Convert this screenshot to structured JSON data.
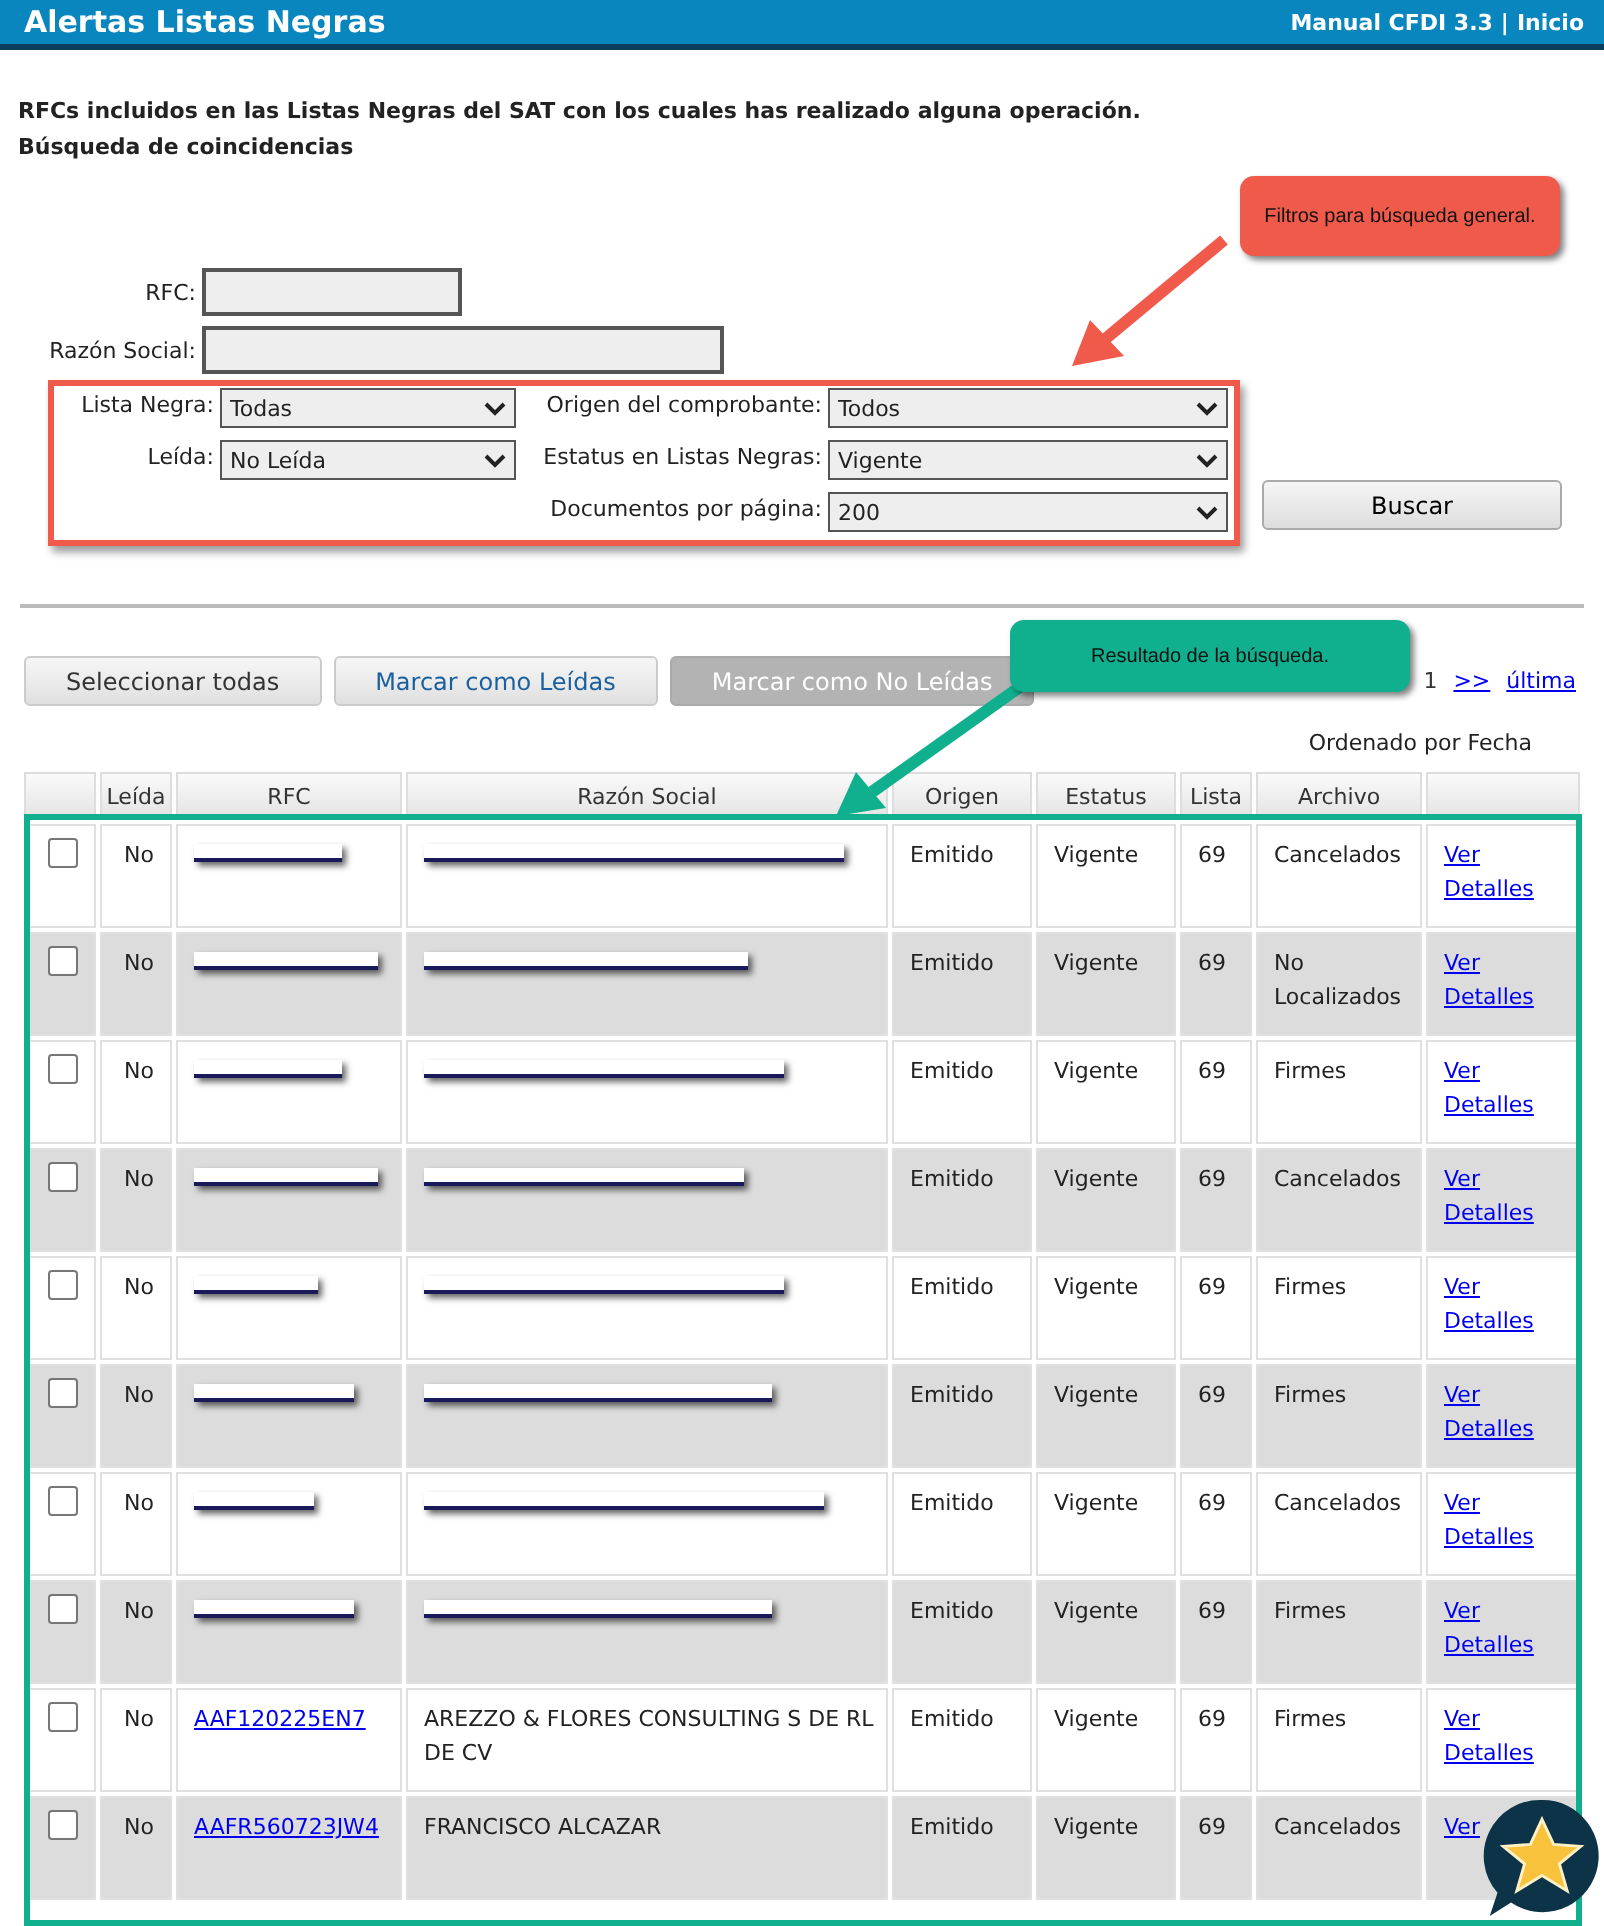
{
  "header": {
    "title": "Alertas Listas Negras",
    "links": [
      "Manual CFDI 3.3",
      "Inicio"
    ],
    "separator": "|"
  },
  "intro": [
    "RFCs incluidos en las Listas Negras del SAT con los cuales has realizado alguna operación.",
    "Búsqueda de coincidencias"
  ],
  "callouts": [
    {
      "text": "Filtros para búsqueda general.",
      "color": "#f05a4b"
    },
    {
      "text": "Resultado de la búsqueda.",
      "color": "#10b08e"
    }
  ],
  "search_fields": [
    {
      "label": "RFC:",
      "kind": "short"
    },
    {
      "label": "Razón Social:",
      "kind": "long"
    }
  ],
  "filters": [
    {
      "label": "Lista Negra:",
      "value": "Todas"
    },
    {
      "label": "Origen del comprobante:",
      "value": "Todos"
    },
    {
      "label": "Leída:",
      "value": "No Leída"
    },
    {
      "label": "Estatus en Listas Negras:",
      "value": "Vigente"
    },
    {
      "label": "Documentos por página:",
      "value": "200"
    }
  ],
  "search_button": "Buscar",
  "actions": [
    {
      "label": "Seleccionar todas",
      "disabled": false,
      "kind": "plain"
    },
    {
      "label": "Marcar como Leídas",
      "disabled": false,
      "kind": "accent"
    },
    {
      "label": "Marcar como No Leídas",
      "disabled": true,
      "kind": "plain"
    }
  ],
  "pager": {
    "page": "1",
    "next": ">>",
    "last": "última"
  },
  "sort_note": "Ordenado por Fecha",
  "table": {
    "columns": [
      "Leída",
      "RFC",
      "Razón Social",
      "Origen",
      "Estatus",
      "Lista",
      "Archivo"
    ],
    "rows": [
      {
        "checked": false,
        "leida": "No",
        "redacted": true,
        "origen": "Emitido",
        "estatus": "Vigente",
        "lista": "69",
        "archivo": "Cancelados",
        "link": "Ver Detalles"
      },
      {
        "checked": false,
        "leida": "No",
        "redacted": true,
        "origen": "Emitido",
        "estatus": "Vigente",
        "lista": "69",
        "archivo": "No Localizados",
        "link": "Ver Detalles"
      },
      {
        "checked": false,
        "leida": "No",
        "redacted": true,
        "origen": "Emitido",
        "estatus": "Vigente",
        "lista": "69",
        "archivo": "Firmes",
        "link": "Ver Detalles"
      },
      {
        "checked": false,
        "leida": "No",
        "redacted": true,
        "origen": "Emitido",
        "estatus": "Vigente",
        "lista": "69",
        "archivo": "Cancelados",
        "link": "Ver Detalles"
      },
      {
        "checked": false,
        "leida": "No",
        "redacted": true,
        "origen": "Emitido",
        "estatus": "Vigente",
        "lista": "69",
        "archivo": "Firmes",
        "link": "Ver Detalles"
      },
      {
        "checked": false,
        "leida": "No",
        "redacted": true,
        "origen": "Emitido",
        "estatus": "Vigente",
        "lista": "69",
        "archivo": "Firmes",
        "link": "Ver Detalles"
      },
      {
        "checked": false,
        "leida": "No",
        "redacted": true,
        "origen": "Emitido",
        "estatus": "Vigente",
        "lista": "69",
        "archivo": "Cancelados",
        "link": "Ver Detalles"
      },
      {
        "checked": false,
        "leida": "No",
        "redacted": true,
        "origen": "Emitido",
        "estatus": "Vigente",
        "lista": "69",
        "archivo": "Firmes",
        "link": "Ver Detalles"
      },
      {
        "checked": false,
        "leida": "No",
        "redacted": false,
        "rfc": "AAF120225EN7",
        "razon_social": "AREZZO & FLORES CONSULTING S DE RL DE CV",
        "origen": "Emitido",
        "estatus": "Vigente",
        "lista": "69",
        "archivo": "Firmes",
        "link": "Ver Detalles"
      },
      {
        "checked": false,
        "leida": "No",
        "redacted": false,
        "rfc": "AAFR560723JW4",
        "razon_social": "FRANCISCO ALCAZAR",
        "origen": "Emitido",
        "estatus": "Vigente",
        "lista": "69",
        "archivo": "Cancelados",
        "link": "Ver"
      }
    ]
  }
}
